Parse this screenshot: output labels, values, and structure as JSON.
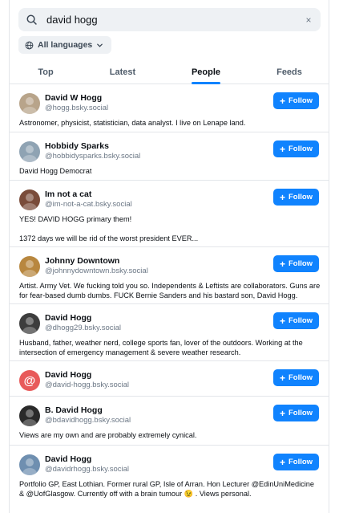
{
  "search": {
    "value": "david hogg",
    "clear_glyph": "×"
  },
  "language_filter": {
    "label": "All languages",
    "icon": "globe-icon"
  },
  "tabs": [
    {
      "label": "Top",
      "active": false
    },
    {
      "label": "Latest",
      "active": false
    },
    {
      "label": "People",
      "active": true
    },
    {
      "label": "Feeds",
      "active": false
    }
  ],
  "follow_label": "Follow",
  "accent_color": "#1083fe",
  "people": [
    {
      "name": "David W Hogg",
      "handle": "@hogg.bsky.social",
      "bio": "Astronomer, physicist, statistician, data analyst. I live on Lenape land.",
      "avatar_color": "#b8a48a"
    },
    {
      "name": "Hobbidy Sparks",
      "handle": "@hobbidysparks.bsky.social",
      "bio": "David Hogg Democrat",
      "avatar_color": "#8fa3b3"
    },
    {
      "name": "Im not a cat",
      "handle": "@im-not-a-cat.bsky.social",
      "bio": "YES! DAVID HOGG primary them!\n\n1372 days we will be rid of the worst president EVER...",
      "avatar_color": "#7a4c3a"
    },
    {
      "name": "Johnny Downtown",
      "handle": "@johnnydowntown.bsky.social",
      "bio": "Artist. Army Vet. We fucking told you so. Independents & Leftists are collaborators. Guns are for fear-based dumb dumbs. FUCK Bernie Sanders and his bastard son, David Hogg.",
      "avatar_color": "#b8873f"
    },
    {
      "name": "David Hogg",
      "handle": "@dhogg29.bsky.social",
      "bio": "Husband, father, weather nerd, college sports fan, lover of the outdoors. Working at the intersection of emergency management & severe weather research.",
      "avatar_color": "#3d3d3d"
    },
    {
      "name": "David Hogg",
      "handle": "@david-hogg.bsky.social",
      "bio": "",
      "avatar_color": "#e85a5a",
      "avatar_glyph": "@"
    },
    {
      "name": "B. David Hogg",
      "handle": "@bdavidhogg.bsky.social",
      "bio": "Views are my own and are probably extremely cynical.",
      "avatar_color": "#2a2a2a"
    },
    {
      "name": "David Hogg",
      "handle": "@davidrhogg.bsky.social",
      "bio": "Portfolio GP, East Lothian. Former rural GP, Isle of Arran. Hon Lecturer @EdinUniMedicine & @UofGlasgow. Currently off with a brain tumour 😉 . Views personal.",
      "avatar_color": "#6f8fb0"
    }
  ]
}
